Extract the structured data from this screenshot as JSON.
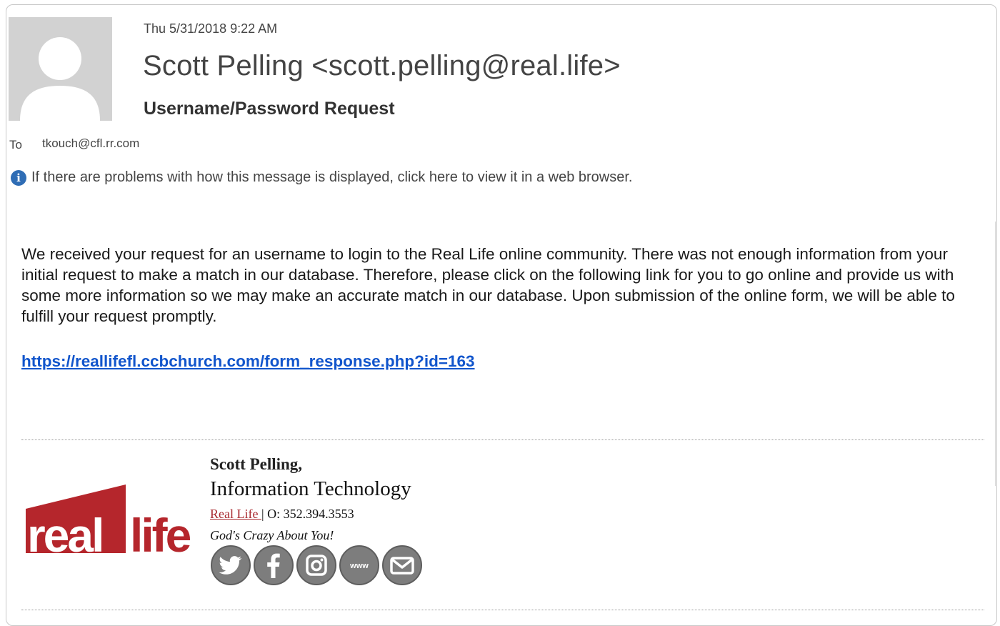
{
  "header": {
    "date": "Thu 5/31/2018 9:22 AM",
    "sender": "Scott Pelling <scott.pelling@real.life>",
    "subject": "Username/Password Request",
    "to_label": "To",
    "to_value": "tkouch@cfl.rr.com"
  },
  "infobar": {
    "icon": "info-icon",
    "text": "If there are problems with how this message is displayed, click here to view it in a web browser."
  },
  "body": {
    "paragraph": "We received your request for an username to login to the Real Life online community.  There was not enough information from your initial request to make a match in our database. Therefore, please click on the following link for you to go online and provide us with some more information so we may make an accurate match in our database.  Upon submission of the online form, we will be able to fulfill your request promptly.",
    "link": "https://reallifefl.ccbchurch.com/form_response.php?id=163"
  },
  "signature": {
    "name": "Scott Pelling,",
    "title": "Information Technology",
    "org": "Real Life ",
    "phone": "| O: 352.394.3553",
    "tagline": "God's Crazy About You!",
    "logo_text": "real life",
    "brand_color": "#b5262c",
    "socials": [
      "twitter-icon",
      "facebook-icon",
      "instagram-icon",
      "website-icon",
      "email-icon"
    ],
    "website_icon_text": "www"
  },
  "colors": {
    "link": "#1155cc",
    "info": "#2f6db5"
  }
}
